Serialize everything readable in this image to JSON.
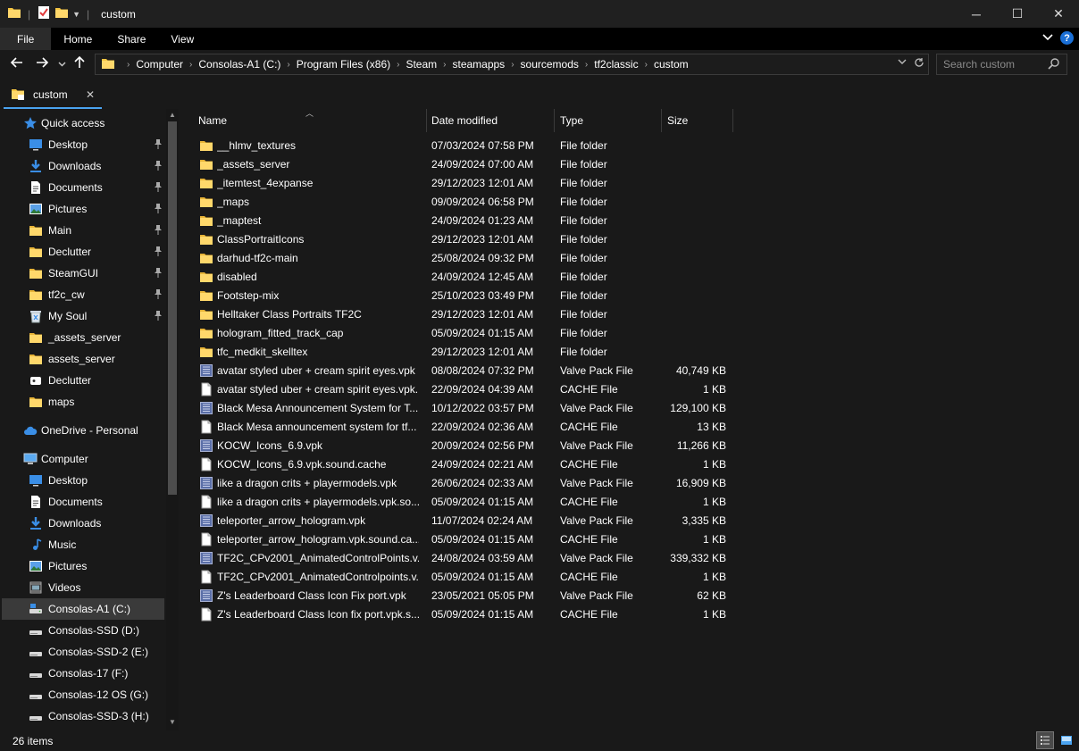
{
  "window": {
    "title": "custom",
    "minimize_glyph": "─",
    "maximize_glyph": "☐",
    "close_glyph": "✕"
  },
  "ribbon": {
    "tabs": [
      "File",
      "Home",
      "Share",
      "View"
    ]
  },
  "address": {
    "crumbs": [
      "Computer",
      "Consolas-A1 (C:)",
      "Program Files (x86)",
      "Steam",
      "steamapps",
      "sourcemods",
      "tf2classic",
      "custom"
    ]
  },
  "search": {
    "placeholder": "Search custom"
  },
  "tab": {
    "label": "custom"
  },
  "sidebar": {
    "items": [
      {
        "label": "Quick access",
        "icon": "star-icon",
        "level": 0,
        "pinned": false
      },
      {
        "label": "Desktop",
        "icon": "desktop-icon",
        "level": 1,
        "pinned": true
      },
      {
        "label": "Downloads",
        "icon": "download-arrow-icon",
        "level": 1,
        "pinned": true
      },
      {
        "label": "Documents",
        "icon": "documents-icon",
        "level": 1,
        "pinned": true
      },
      {
        "label": "Pictures",
        "icon": "pictures-icon",
        "level": 1,
        "pinned": true
      },
      {
        "label": "Main",
        "icon": "folder-icon",
        "level": 1,
        "pinned": true
      },
      {
        "label": "Declutter",
        "icon": "folder-icon",
        "level": 1,
        "pinned": true
      },
      {
        "label": "SteamGUI",
        "icon": "folder-icon",
        "level": 1,
        "pinned": true
      },
      {
        "label": "tf2c_cw",
        "icon": "folder-icon",
        "level": 1,
        "pinned": true
      },
      {
        "label": "My Soul",
        "icon": "recycle-bin-icon",
        "level": 1,
        "pinned": true
      },
      {
        "label": "_assets_server",
        "icon": "folder-icon",
        "level": 1,
        "pinned": false
      },
      {
        "label": "assets_server",
        "icon": "folder-icon",
        "level": 1,
        "pinned": false
      },
      {
        "label": "Declutter",
        "icon": "app-icon",
        "level": 1,
        "pinned": false
      },
      {
        "label": "maps",
        "icon": "folder-icon",
        "level": 1,
        "pinned": false
      },
      {
        "label": "OneDrive - Personal",
        "icon": "cloud-icon",
        "level": 0,
        "pinned": false
      },
      {
        "label": "Computer",
        "icon": "computer-icon",
        "level": 0,
        "pinned": false
      },
      {
        "label": "Desktop",
        "icon": "desktop-icon",
        "level": 1,
        "pinned": false
      },
      {
        "label": "Documents",
        "icon": "documents-icon",
        "level": 1,
        "pinned": false
      },
      {
        "label": "Downloads",
        "icon": "download-arrow-icon",
        "level": 1,
        "pinned": false
      },
      {
        "label": "Music",
        "icon": "music-note-icon",
        "level": 1,
        "pinned": false
      },
      {
        "label": "Pictures",
        "icon": "pictures-icon",
        "level": 1,
        "pinned": false
      },
      {
        "label": "Videos",
        "icon": "video-icon",
        "level": 1,
        "pinned": false
      },
      {
        "label": "Consolas-A1 (C:)",
        "icon": "system-drive-icon",
        "level": 1,
        "pinned": false,
        "selected": true
      },
      {
        "label": "Consolas-SSD (D:)",
        "icon": "drive-icon",
        "level": 1,
        "pinned": false
      },
      {
        "label": "Consolas-SSD-2 (E:)",
        "icon": "drive-icon",
        "level": 1,
        "pinned": false
      },
      {
        "label": "Consolas-17 (F:)",
        "icon": "drive-icon",
        "level": 1,
        "pinned": false
      },
      {
        "label": "Consolas-12 OS (G:)",
        "icon": "drive-icon",
        "level": 1,
        "pinned": false
      },
      {
        "label": "Consolas-SSD-3 (H:)",
        "icon": "drive-icon",
        "level": 1,
        "pinned": false
      }
    ]
  },
  "columns": {
    "name": "Name",
    "date": "Date modified",
    "type": "Type",
    "size": "Size"
  },
  "files": [
    {
      "name": "__hlmv_textures",
      "date": "07/03/2024 07:58 PM",
      "type": "File folder",
      "size": "",
      "kind": "folder"
    },
    {
      "name": "_assets_server",
      "date": "24/09/2024 07:00 AM",
      "type": "File folder",
      "size": "",
      "kind": "folder"
    },
    {
      "name": "_itemtest_4expanse",
      "date": "29/12/2023 12:01 AM",
      "type": "File folder",
      "size": "",
      "kind": "folder"
    },
    {
      "name": "_maps",
      "date": "09/09/2024 06:58 PM",
      "type": "File folder",
      "size": "",
      "kind": "folder"
    },
    {
      "name": "_maptest",
      "date": "24/09/2024 01:23 AM",
      "type": "File folder",
      "size": "",
      "kind": "folder"
    },
    {
      "name": "ClassPortraitIcons",
      "date": "29/12/2023 12:01 AM",
      "type": "File folder",
      "size": "",
      "kind": "folder"
    },
    {
      "name": "darhud-tf2c-main",
      "date": "25/08/2024 09:32 PM",
      "type": "File folder",
      "size": "",
      "kind": "folder"
    },
    {
      "name": "disabled",
      "date": "24/09/2024 12:45 AM",
      "type": "File folder",
      "size": "",
      "kind": "folder"
    },
    {
      "name": "Footstep-mix",
      "date": "25/10/2023 03:49 PM",
      "type": "File folder",
      "size": "",
      "kind": "folder"
    },
    {
      "name": "Helltaker Class Portraits TF2C",
      "date": "29/12/2023 12:01 AM",
      "type": "File folder",
      "size": "",
      "kind": "folder"
    },
    {
      "name": "hologram_fitted_track_cap",
      "date": "05/09/2024 01:15 AM",
      "type": "File folder",
      "size": "",
      "kind": "folder"
    },
    {
      "name": "tfc_medkit_skelltex",
      "date": "29/12/2023 12:01 AM",
      "type": "File folder",
      "size": "",
      "kind": "folder"
    },
    {
      "name": "avatar styled uber + cream spirit eyes.vpk",
      "date": "08/08/2024 07:32 PM",
      "type": "Valve Pack File",
      "size": "40,749 KB",
      "kind": "vpk"
    },
    {
      "name": "avatar styled uber + cream spirit eyes.vpk...",
      "date": "22/09/2024 04:39 AM",
      "type": "CACHE File",
      "size": "1 KB",
      "kind": "cache"
    },
    {
      "name": "Black Mesa Announcement System for T...",
      "date": "10/12/2022 03:57 PM",
      "type": "Valve Pack File",
      "size": "129,100 KB",
      "kind": "vpk"
    },
    {
      "name": "Black Mesa announcement system for tf...",
      "date": "22/09/2024 02:36 AM",
      "type": "CACHE File",
      "size": "13 KB",
      "kind": "cache"
    },
    {
      "name": "KOCW_Icons_6.9.vpk",
      "date": "20/09/2024 02:56 PM",
      "type": "Valve Pack File",
      "size": "11,266 KB",
      "kind": "vpk"
    },
    {
      "name": "KOCW_Icons_6.9.vpk.sound.cache",
      "date": "24/09/2024 02:21 AM",
      "type": "CACHE File",
      "size": "1 KB",
      "kind": "cache"
    },
    {
      "name": "like a dragon crits + playermodels.vpk",
      "date": "26/06/2024 02:33 AM",
      "type": "Valve Pack File",
      "size": "16,909 KB",
      "kind": "vpk"
    },
    {
      "name": "like a dragon crits + playermodels.vpk.so...",
      "date": "05/09/2024 01:15 AM",
      "type": "CACHE File",
      "size": "1 KB",
      "kind": "cache"
    },
    {
      "name": "teleporter_arrow_hologram.vpk",
      "date": "11/07/2024 02:24 AM",
      "type": "Valve Pack File",
      "size": "3,335 KB",
      "kind": "vpk"
    },
    {
      "name": "teleporter_arrow_hologram.vpk.sound.ca...",
      "date": "05/09/2024 01:15 AM",
      "type": "CACHE File",
      "size": "1 KB",
      "kind": "cache"
    },
    {
      "name": "TF2C_CPv2001_AnimatedControlPoints.v...",
      "date": "24/08/2024 03:59 AM",
      "type": "Valve Pack File",
      "size": "339,332 KB",
      "kind": "vpk"
    },
    {
      "name": "TF2C_CPv2001_AnimatedControlpoints.v...",
      "date": "05/09/2024 01:15 AM",
      "type": "CACHE File",
      "size": "1 KB",
      "kind": "cache"
    },
    {
      "name": "Z's Leaderboard Class Icon Fix port.vpk",
      "date": "23/05/2021 05:05 PM",
      "type": "Valve Pack File",
      "size": "62 KB",
      "kind": "vpk"
    },
    {
      "name": "Z's Leaderboard Class Icon fix port.vpk.s...",
      "date": "05/09/2024 01:15 AM",
      "type": "CACHE File",
      "size": "1 KB",
      "kind": "cache"
    }
  ],
  "status": {
    "count": "26 items"
  },
  "colors": {
    "folder": "#f5c542",
    "accent": "#4aa3f0",
    "selected": "#3a3a3a",
    "background": "#191919"
  }
}
